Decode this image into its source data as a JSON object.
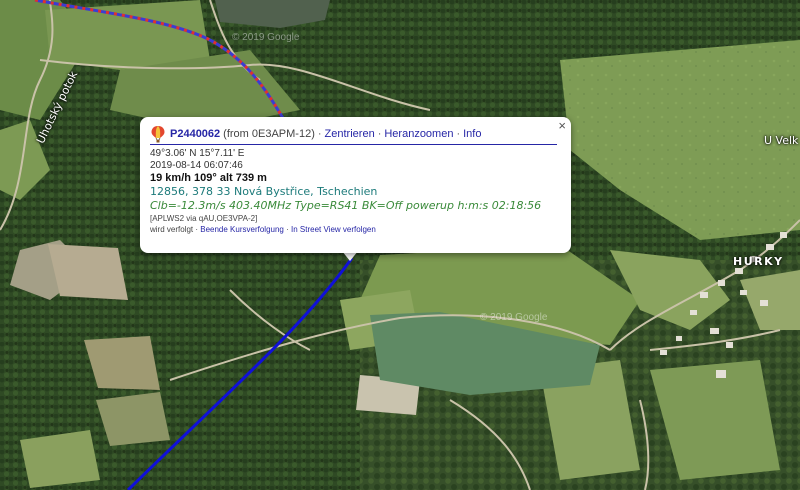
{
  "map": {
    "labels": {
      "road": "Uhotský potok",
      "village": "HURKY",
      "edge": "U Velk"
    },
    "watermarks": [
      "© 2019 Google",
      "© 2019 Google"
    ],
    "colors": {
      "track_upper": "#3c3cd2",
      "track_dots": "#e03030",
      "track_lower": "#1010d8"
    }
  },
  "popup": {
    "icon": "balloon-icon",
    "callsign": "P2440062",
    "from": "(from 0E3APM-12)",
    "actions": [
      "Zentrieren",
      "Heranzoomen",
      "Info"
    ],
    "position": "49°3.06' N 15°7.11' E",
    "timestamp": "2019-08-14 06:07:46",
    "motion": "19 km/h 109° alt 739 m",
    "address": "12856, 378 33 Nová Bystřice, Tschechien",
    "comment": "Clb=-12.3m/s 403.40MHz Type=RS41 BK=Off powerup h:m:s 02:18:56",
    "path": "[APLWS2 via qAU,OE3VPA-2]",
    "footer_prefix": "wird verfolgt ·",
    "footer_links": [
      "Beende Kursverfolgung",
      "In Street View verfolgen"
    ],
    "close_label": "×"
  }
}
